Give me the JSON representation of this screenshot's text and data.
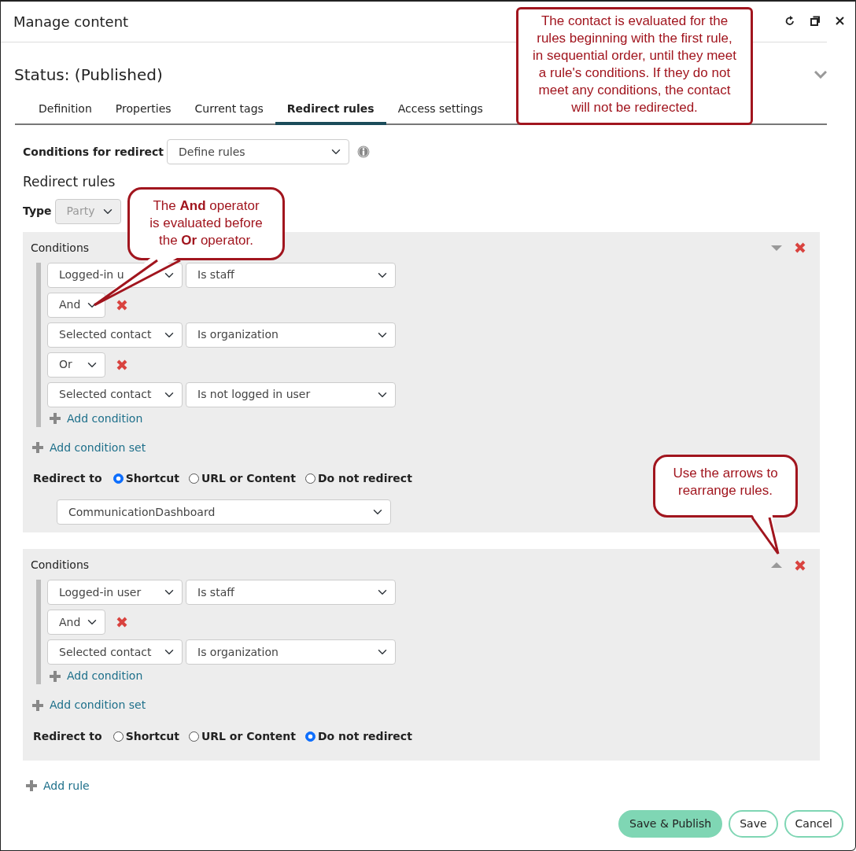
{
  "window": {
    "title": "Manage content"
  },
  "status": "Status: (Published)",
  "tabs": [
    {
      "label": "Definition",
      "selected": false
    },
    {
      "label": "Properties",
      "selected": false
    },
    {
      "label": "Current tags",
      "selected": false
    },
    {
      "label": "Redirect rules",
      "selected": true
    },
    {
      "label": "Access settings",
      "selected": false
    }
  ],
  "conditions_for_redirect": {
    "label": "Conditions for redirect",
    "value": "Define rules"
  },
  "section_title": "Redirect rules",
  "type": {
    "label": "Type",
    "value": "Party",
    "disabled": true
  },
  "rules": [
    {
      "title": "Conditions",
      "can_move_up": false,
      "can_move_down": true,
      "condition_sets": [
        {
          "items": [
            {
              "kind": "condition",
              "subject": "Logged-in u",
              "test": "Is staff"
            },
            {
              "kind": "operator",
              "value": "And"
            },
            {
              "kind": "condition",
              "subject": "Selected contact",
              "test": "Is organization"
            },
            {
              "kind": "operator",
              "value": "Or"
            },
            {
              "kind": "condition",
              "subject": "Selected contact",
              "test": "Is not logged in user"
            }
          ],
          "add_condition": "Add condition"
        }
      ],
      "add_condition_set": "Add condition set",
      "redirect": {
        "label": "Redirect to",
        "options": [
          {
            "label": "Shortcut",
            "selected": true
          },
          {
            "label": "URL or Content",
            "selected": false
          },
          {
            "label": "Do not redirect",
            "selected": false
          }
        ],
        "shortcut": "CommunicationDashboard"
      }
    },
    {
      "title": "Conditions",
      "can_move_up": true,
      "can_move_down": false,
      "condition_sets": [
        {
          "items": [
            {
              "kind": "condition",
              "subject": "Logged-in user",
              "test": "Is staff"
            },
            {
              "kind": "operator",
              "value": "And"
            },
            {
              "kind": "condition",
              "subject": "Selected contact",
              "test": "Is organization"
            }
          ],
          "add_condition": "Add condition"
        }
      ],
      "add_condition_set": "Add condition set",
      "redirect": {
        "label": "Redirect to",
        "options": [
          {
            "label": "Shortcut",
            "selected": false
          },
          {
            "label": "URL or Content",
            "selected": false
          },
          {
            "label": "Do not redirect",
            "selected": true
          }
        ]
      }
    }
  ],
  "add_rule": "Add rule",
  "buttons": [
    {
      "label": "Save & Publish",
      "kind": "primary"
    },
    {
      "label": "Save",
      "kind": "outline"
    },
    {
      "label": "Cancel",
      "kind": "outline"
    }
  ],
  "callouts": [
    {
      "text": "The contact is evaluated for the rules beginning with the first rule, in sequential order, until they meet a rule's conditions. If they do not meet any conditions, the contact will not be redirected."
    },
    {
      "text": "The **And** operator is evaluated before the **Or** operator."
    },
    {
      "text": "Use the arrows to rearrange rules."
    }
  ]
}
